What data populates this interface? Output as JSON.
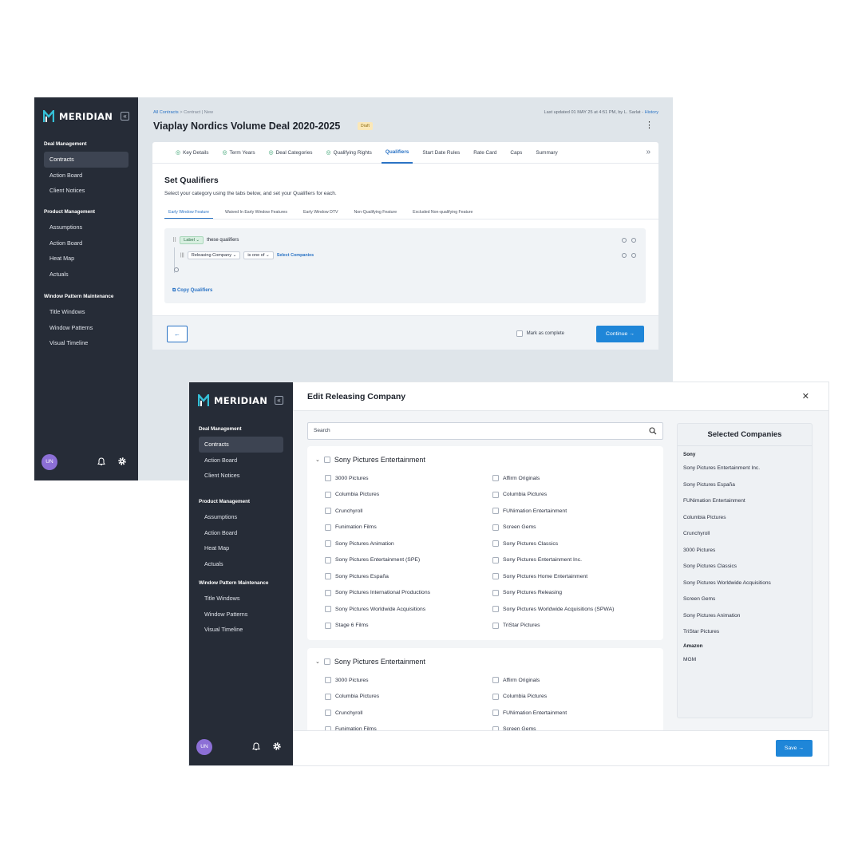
{
  "brand": {
    "name": "MERIDIAN",
    "collapse": "«"
  },
  "nav": {
    "sections": [
      {
        "heading": "Deal Management",
        "items": [
          "Contracts",
          "Action Board",
          "Client Notices"
        ]
      },
      {
        "heading": "Product Management",
        "items": [
          "Assumptions",
          "Action Board",
          "Heat Map",
          "Actuals"
        ]
      },
      {
        "heading": "Window Pattern Maintenance",
        "items": [
          "Title Windows",
          "Window Patterns",
          "Visual Timeline"
        ]
      }
    ],
    "active_item": "Contracts",
    "avatar": "UN"
  },
  "contract": {
    "crumb_link": "All Contracts",
    "crumb_rest": " > Contract | New",
    "updated_text": "Last updated 01 MAY 25 at 4:51 PM, by  L. Sarlat  - ",
    "history_link": "History",
    "title": "Viaplay Nordics Volume Deal 2020-2025",
    "badge": "Draft",
    "tabs": [
      {
        "label": "Key Details",
        "done": true
      },
      {
        "label": "Term Years",
        "done": true
      },
      {
        "label": "Deal Categories",
        "done": true
      },
      {
        "label": "Qualifying Rights",
        "done": true
      },
      {
        "label": "Qualifiers",
        "active": true
      },
      {
        "label": "Start Date Rules"
      },
      {
        "label": "Rate Card"
      },
      {
        "label": "Caps"
      },
      {
        "label": "Summary"
      }
    ],
    "section_title": "Set Qualifiers",
    "section_sub": "Select your category using the tabs below, and set your Qualifiers for each.",
    "subtabs": [
      "Early Window Feature",
      "Waived In Early Window Features",
      "Early Window DTV",
      "Non-Qualifying Feature",
      "Excluded Non-qualifying Feature"
    ],
    "qualifier": {
      "label_select": "Label",
      "label_text": "these qualifiers",
      "field_select": "Releasing Company",
      "op_select": "is one of",
      "select_link": "Select Companies",
      "copy_link": "Copy Qualifiers"
    },
    "mark_complete": "Mark as complete",
    "continue": "Continue →",
    "back": "←"
  },
  "modal": {
    "title": "Edit Releasing Company",
    "close": "✕",
    "search_placeholder": "Search",
    "groups": [
      {
        "name": "Sony Pictures Entertainment",
        "items": [
          "3000 Pictures",
          "Affirm Originals",
          "Columbia Pictures",
          "Columbia Pictures",
          "Crunchyroll",
          "FUNimation Entertainment",
          "Funimation Films",
          "Screen Gems",
          "Sony Pictures Animation",
          "Sony Pictures Classics",
          "Sony Pictures Entertainment (SPE)",
          "Sony Pictures Entertainment Inc.",
          "Sony Pictures España",
          "Sony Pictures Home Entertainment",
          "Sony Pictures International Productions",
          "Sony Pictures Releasing",
          "Sony Pictures Worldwide Acquisitions",
          "Sony Pictures Worldwide Acquisitions (SPWA)",
          "Stage 6 Films",
          "TriStar Pictures"
        ]
      },
      {
        "name": "Sony Pictures Entertainment",
        "items": [
          "3000 Pictures",
          "Affirm Originals",
          "Columbia Pictures",
          "Columbia Pictures",
          "Crunchyroll",
          "FUNimation Entertainment",
          "Funimation Films",
          "Screen Gems"
        ]
      }
    ],
    "selected_title": "Selected Companies",
    "selected": [
      {
        "group": "Sony",
        "items": [
          "Sony Pictures Entertainment Inc.",
          "Sony Pictures España",
          "FUNimation Entertainment",
          "Columbia Pictures",
          "Crunchyroll",
          "3000 Pictures",
          "Sony Pictures Classics",
          "Sony Pictures Worldwide Acquisitions",
          "Screen Gems",
          "Sony Pictures Animation",
          "TriStar Pictures"
        ]
      },
      {
        "group": "Amazon",
        "items": [
          "MGM"
        ]
      }
    ],
    "save": "Save →"
  },
  "colors": {
    "sidebar": "#262c37",
    "accent": "#1f86d8",
    "logo_accent": "#35c0d8"
  }
}
